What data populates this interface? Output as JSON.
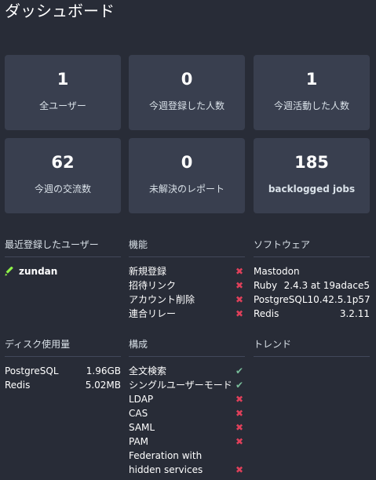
{
  "page": {
    "title": "ダッシュボード"
  },
  "stats": [
    {
      "value": "1",
      "label": "全ユーザー"
    },
    {
      "value": "0",
      "label": "今週登録した人数"
    },
    {
      "value": "1",
      "label": "今週活動した人数"
    },
    {
      "value": "62",
      "label": "今週の交流数"
    },
    {
      "value": "0",
      "label": "未解決のレポート"
    },
    {
      "value": "185",
      "label": "backlogged jobs"
    }
  ],
  "recent_users": {
    "heading": "最近登録したユーザー",
    "users": [
      {
        "name": "zundan",
        "icon": "pencil-icon"
      }
    ]
  },
  "features": {
    "heading": "機能",
    "items": [
      {
        "label": "新規登録",
        "status": "✖"
      },
      {
        "label": "招待リンク",
        "status": "✖"
      },
      {
        "label": "アカウント削除",
        "status": "✖"
      },
      {
        "label": "連合リレー",
        "status": "✖"
      }
    ]
  },
  "software": {
    "heading": "ソフトウェア",
    "items": [
      {
        "label": "Mastodon",
        "value": ""
      },
      {
        "label": "Ruby",
        "value": "2.4.3 at 19adace5"
      },
      {
        "label": "PostgreSQL",
        "value": "10.42.5.1p57"
      },
      {
        "label": "Redis",
        "value": "3.2.11"
      }
    ]
  },
  "disk_usage": {
    "heading": "ディスク使用量",
    "items": [
      {
        "label": "PostgreSQL",
        "value": "1.96GB"
      },
      {
        "label": "Redis",
        "value": "5.02MB"
      }
    ]
  },
  "configuration": {
    "heading": "構成",
    "items": [
      {
        "label": "全文検索",
        "status": "✔"
      },
      {
        "label": "シングルユーザーモード",
        "status": "✔"
      },
      {
        "label": "LDAP",
        "status": "✖"
      },
      {
        "label": "CAS",
        "status": "✖"
      },
      {
        "label": "SAML",
        "status": "✖"
      },
      {
        "label": "PAM",
        "status": "✖"
      },
      {
        "label": "Federation with hidden services",
        "status": "✖"
      }
    ]
  },
  "trends": {
    "heading": "トレンド"
  },
  "colors": {
    "background": "#282c37",
    "card": "#393f4f",
    "error": "#df405a",
    "success": "#79bd9a",
    "accent": "#8ef249"
  }
}
